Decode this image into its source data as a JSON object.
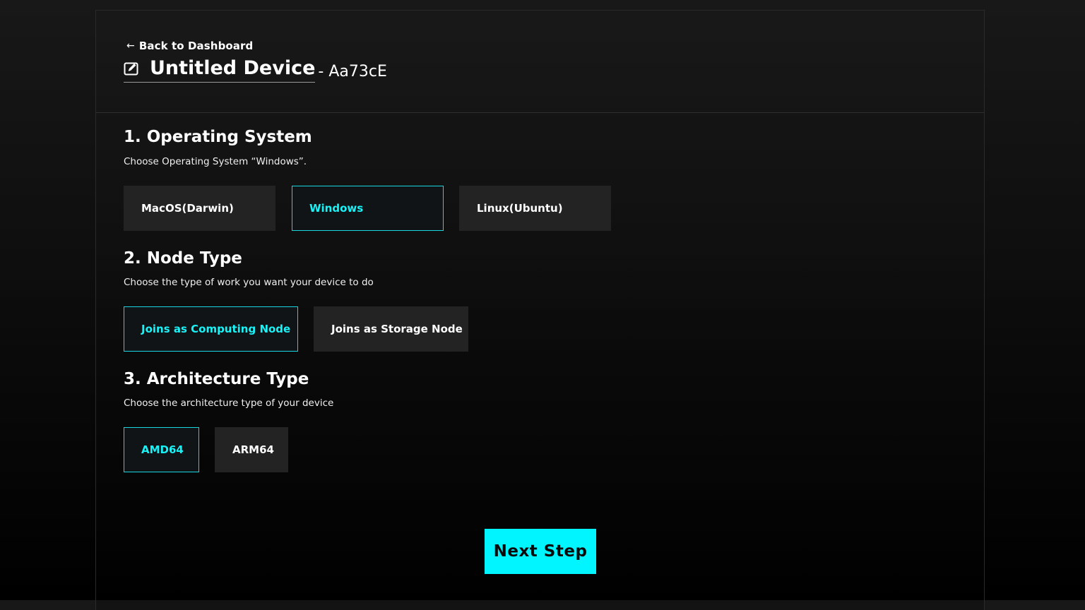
{
  "header": {
    "back_label": "Back to Dashboard",
    "device_name": "Untitled Device",
    "device_id": "- Aa73cE"
  },
  "sections": [
    {
      "title": "1. Operating System",
      "description": "Choose Operating System “Windows”.",
      "options": [
        "MacOS(Darwin)",
        "Windows",
        "Linux(Ubuntu)"
      ],
      "selected": "Windows"
    },
    {
      "title": "2. Node Type",
      "description": "Choose the type of work you want your device to do",
      "options": [
        "Joins as Computing Node",
        "Joins as Storage Node"
      ],
      "selected": "Joins as Computing Node"
    },
    {
      "title": "3. Architecture Type",
      "description": "Choose the architecture type of your device",
      "options": [
        "AMD64",
        "ARM64"
      ],
      "selected": "AMD64"
    }
  ],
  "next_button": "Next Step",
  "colors": {
    "accent": "#00f5ff",
    "accent_text": "#19f2f7",
    "option_bg": "#232323",
    "background": "#0f0f0f"
  },
  "icons": {
    "back": "arrow-left-icon",
    "edit": "edit-icon"
  }
}
